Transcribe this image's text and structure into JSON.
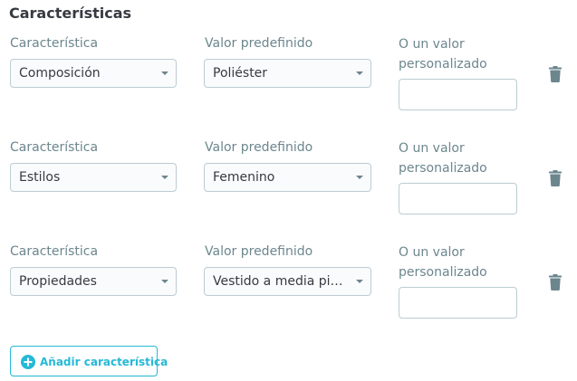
{
  "section": {
    "title": "Características"
  },
  "labels": {
    "feature": "Característica",
    "predefined": "Valor predefinido",
    "custom": "O un valor personalizado"
  },
  "rows": [
    {
      "feature": "Composición",
      "predefined": "Poliéster",
      "custom_value": ""
    },
    {
      "feature": "Estilos",
      "predefined": "Femenino",
      "custom_value": ""
    },
    {
      "feature": "Propiedades",
      "predefined": "Vestido a media pierna",
      "custom_value": ""
    }
  ],
  "add_button": {
    "label": "Añadir característica"
  },
  "icons": {
    "delete": "trash-icon",
    "add": "plus-circle-icon",
    "dropdown": "caret-down-icon"
  },
  "colors": {
    "accent": "#25b9d7",
    "label": "#6c868e",
    "text": "#363a41",
    "border": "#bbcdd2",
    "trash": "#6c868e"
  }
}
